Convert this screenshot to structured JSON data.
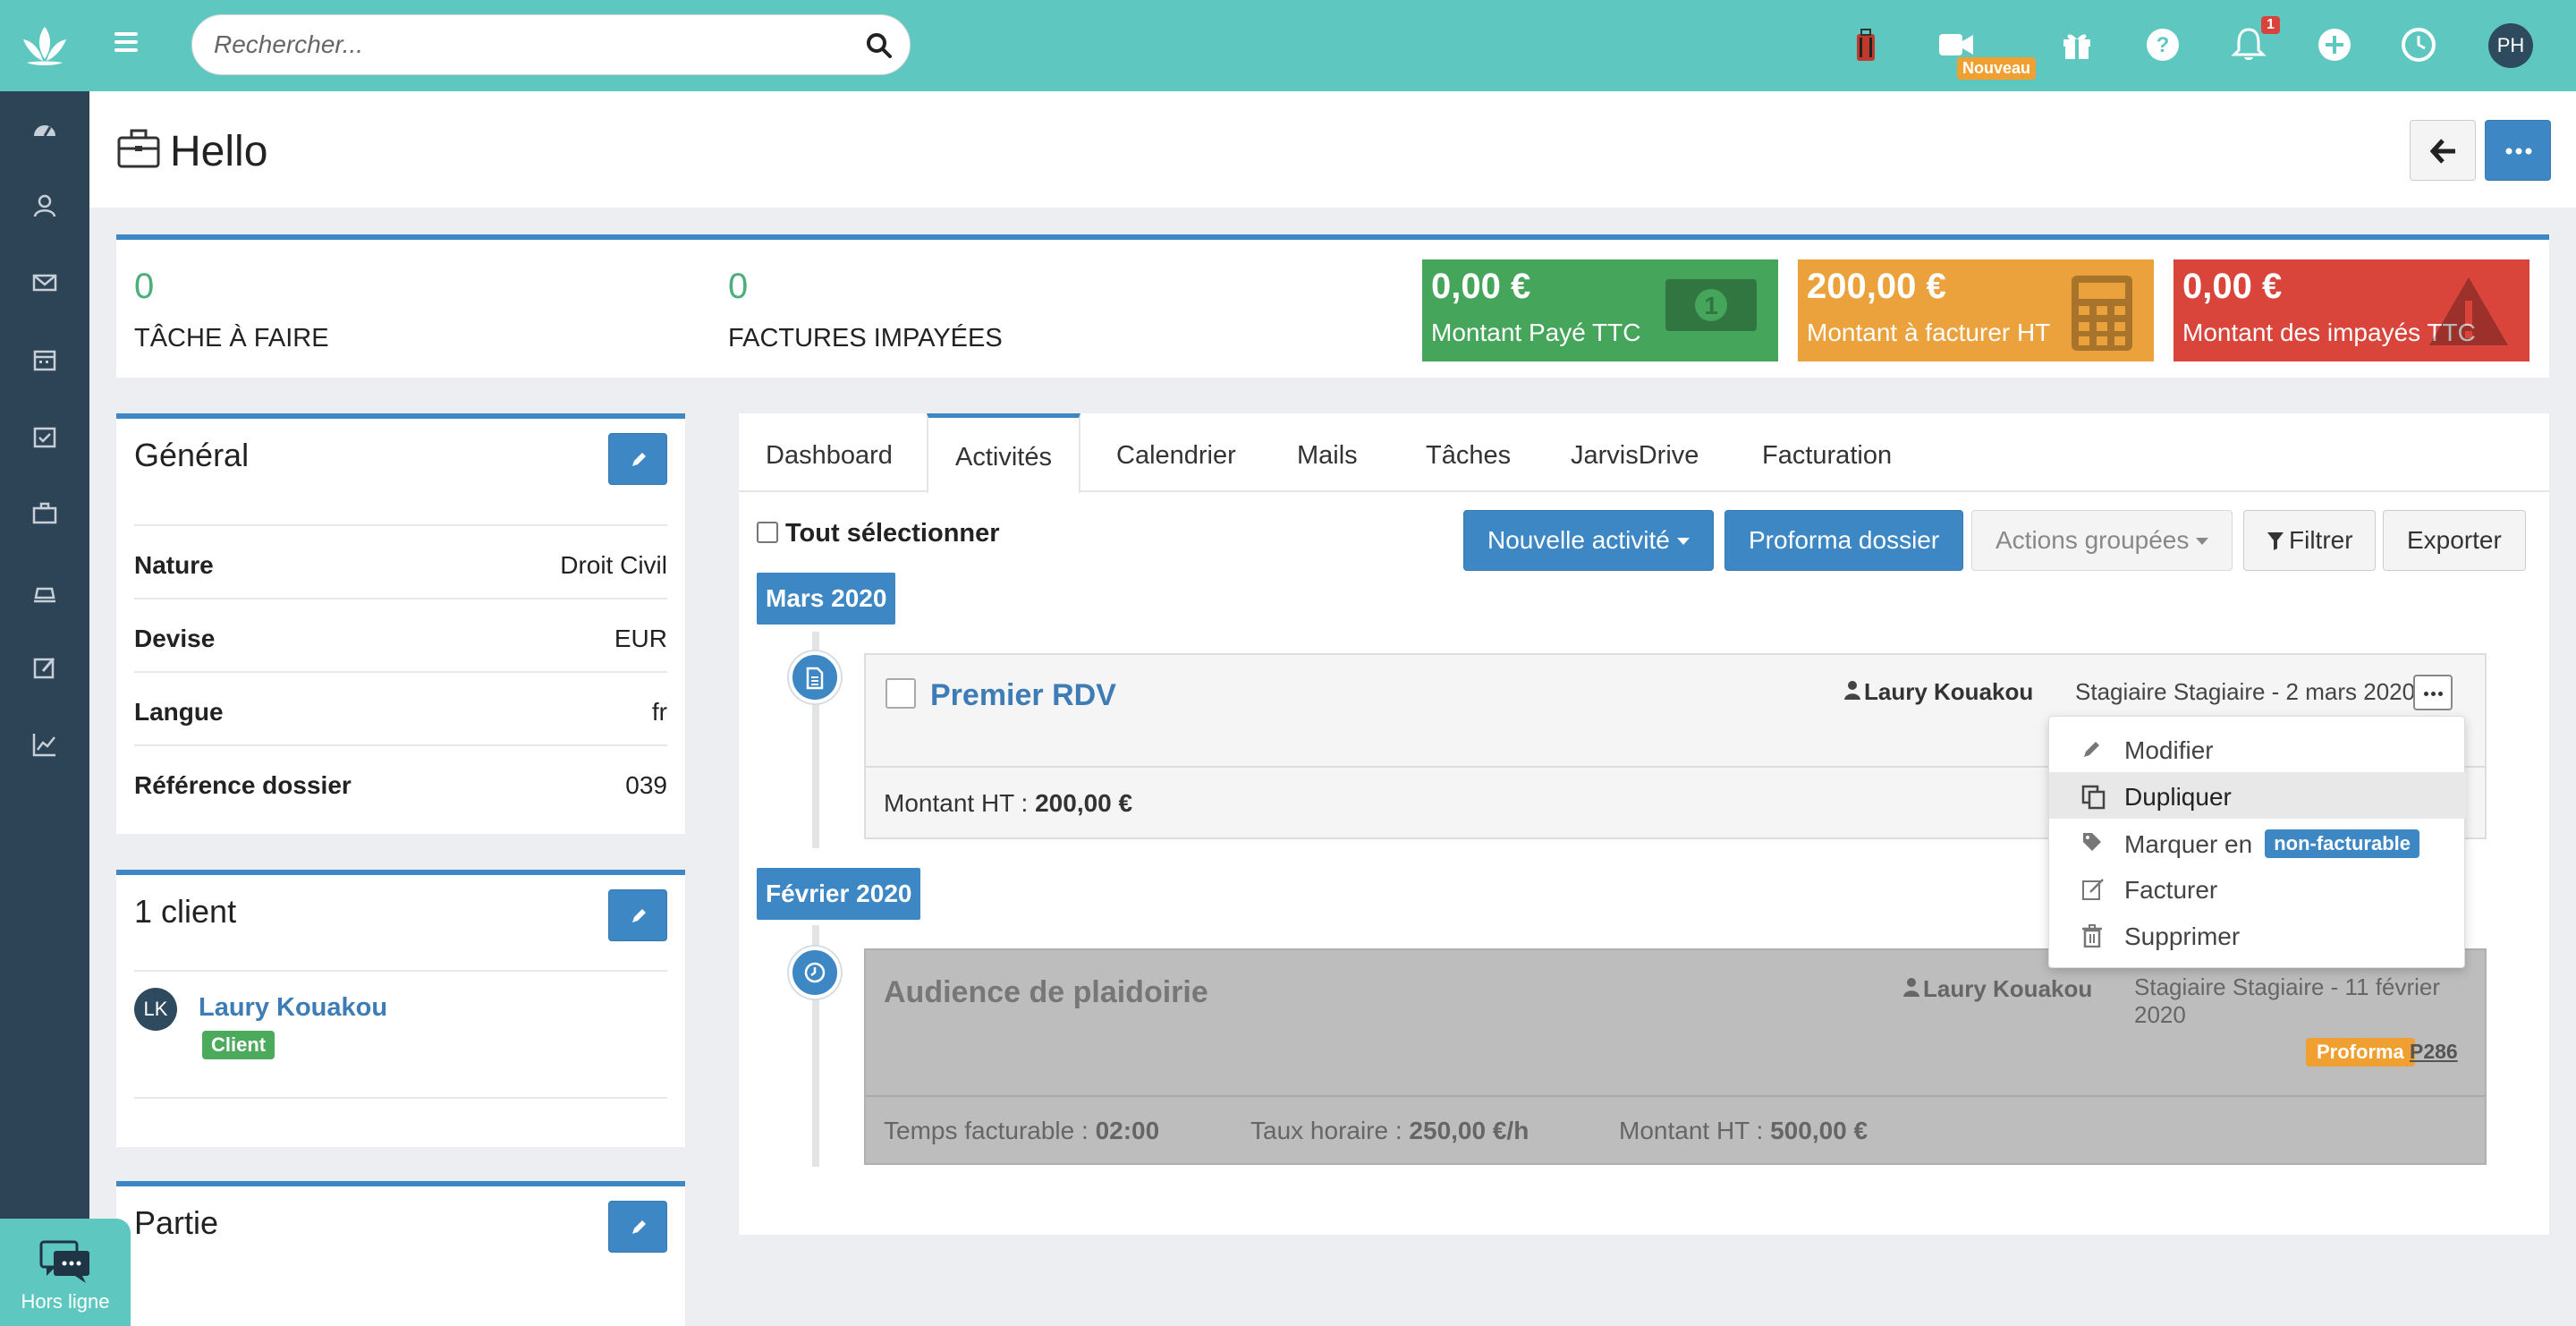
{
  "search": {
    "placeholder": "Rechercher..."
  },
  "topbar": {
    "nouveau_badge": "Nouveau",
    "notif_count": "1",
    "user_initials": "PH"
  },
  "page": {
    "title": "Hello"
  },
  "stats": {
    "tasks": {
      "value": "0",
      "label": "TÂCHE À FAIRE"
    },
    "invoices": {
      "value": "0",
      "label": "FACTURES IMPAYÉES"
    },
    "tiles": [
      {
        "amount": "0,00 €",
        "label": "Montant Payé TTC",
        "color": "#45a55a",
        "icon": "money-icon"
      },
      {
        "amount": "200,00 €",
        "label": "Montant à facturer HT",
        "color": "#eba23c",
        "icon": "calculator-icon"
      },
      {
        "amount": "0,00 €",
        "label": "Montant des impayés TTC",
        "color": "#d9453b",
        "icon": "warning-icon"
      }
    ]
  },
  "general": {
    "title": "Général",
    "rows": [
      {
        "key": "Nature",
        "value": "Droit Civil"
      },
      {
        "key": "Devise",
        "value": "EUR"
      },
      {
        "key": "Langue",
        "value": "fr"
      },
      {
        "key": "Référence dossier",
        "value": "039"
      }
    ]
  },
  "clients": {
    "title": "1 client",
    "items": [
      {
        "initials": "LK",
        "name": "Laury Kouakou",
        "badge": "Client"
      }
    ]
  },
  "partie": {
    "title": "Partie"
  },
  "tabs": [
    "Dashboard",
    "Activités",
    "Calendrier",
    "Mails",
    "Tâches",
    "JarvisDrive",
    "Facturation"
  ],
  "active_tab": "Activités",
  "toolbar": {
    "select_all": "Tout sélectionner",
    "new_activity": "Nouvelle activité",
    "proforma": "Proforma dossier",
    "grouped_actions": "Actions groupées",
    "filter": "Filtrer",
    "export": "Exporter"
  },
  "timeline": [
    {
      "month": "Mars 2020",
      "activity": {
        "title": "Premier RDV",
        "user": "Laury Kouakou",
        "meta": "Stagiaire Stagiaire - 2 mars 2020",
        "amount_label": "Montant HT :",
        "amount": "200,00 €"
      }
    },
    {
      "month": "Février 2020",
      "activity": {
        "title": "Audience de plaidoirie",
        "user": "Laury Kouakou",
        "meta": "Stagiaire Stagiaire - 11 février 2020",
        "badge": "Proforma",
        "ref": "P286",
        "time_label": "Temps facturable :",
        "time": "02:00",
        "rate_label": "Taux horaire :",
        "rate": "250,00 €/h",
        "amount_label": "Montant HT :",
        "amount": "500,00 €"
      }
    }
  ],
  "dropdown": {
    "items": [
      {
        "label": "Modifier",
        "icon": "pencil-icon"
      },
      {
        "label": "Dupliquer",
        "icon": "copy-icon"
      },
      {
        "label": "Marquer en",
        "icon": "tag-icon",
        "badge": "non-facturable"
      },
      {
        "label": "Facturer",
        "icon": "edit-icon"
      },
      {
        "label": "Supprimer",
        "icon": "trash-icon"
      }
    ],
    "highlighted": "Dupliquer"
  },
  "chat": {
    "status": "Hors ligne"
  },
  "colors": {
    "teal": "#5ec8c0",
    "sidebar": "#2d4456",
    "primary": "#3d88c4"
  }
}
